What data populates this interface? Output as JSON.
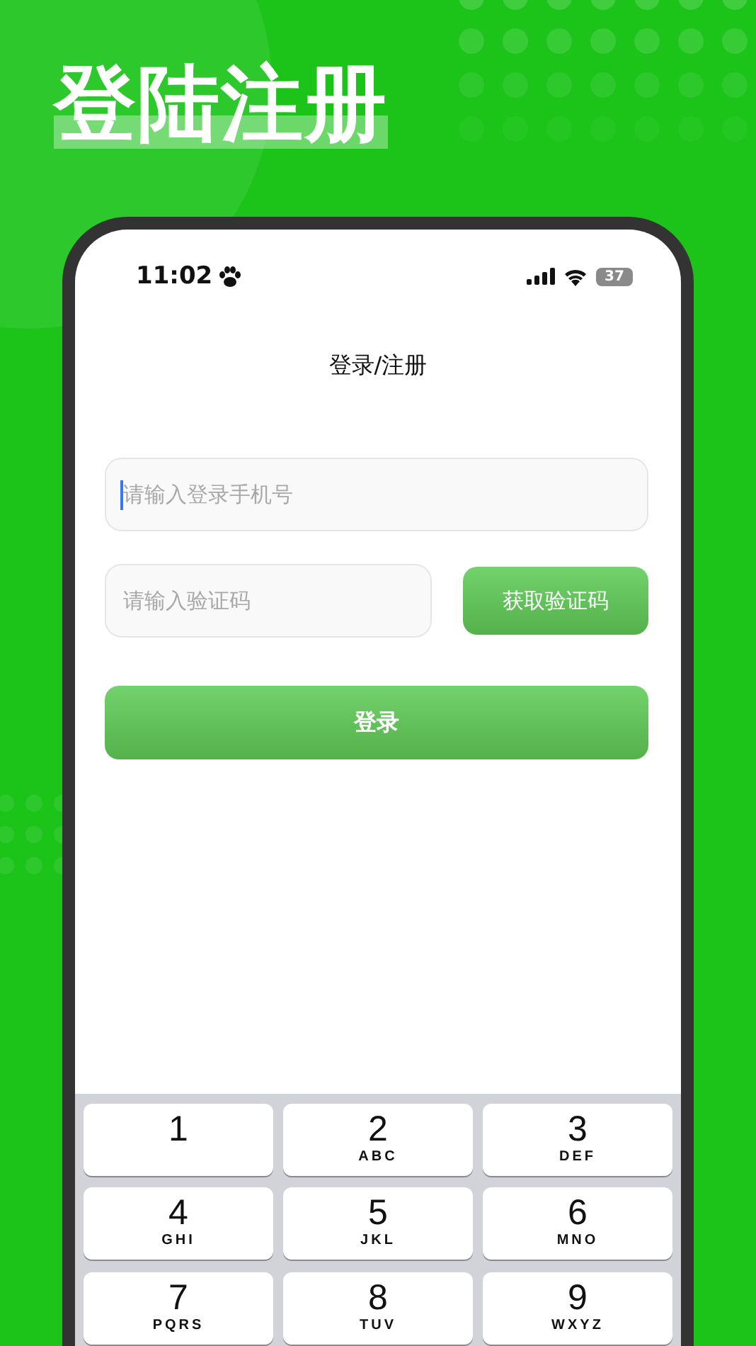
{
  "headline": "登陆注册",
  "status_bar": {
    "time": "11:02",
    "battery": "37"
  },
  "screen_title": "登录/注册",
  "phone_field": {
    "placeholder": "请输入登录手机号",
    "focused": true
  },
  "code_field": {
    "placeholder": "请输入验证码"
  },
  "code_button": "获取验证码",
  "login_button": "登录",
  "keypad": [
    {
      "digit": "1"
    },
    {
      "digit": "2",
      "letters": "ABC"
    },
    {
      "digit": "3",
      "letters": "DEF"
    },
    {
      "digit": "4",
      "letters": "GHI"
    },
    {
      "digit": "5",
      "letters": "JKL"
    },
    {
      "digit": "6",
      "letters": "MNO"
    },
    {
      "digit": "7",
      "letters": "PQRS"
    },
    {
      "digit": "8",
      "letters": "TUV"
    },
    {
      "digit": "9",
      "letters": "WXYZ"
    }
  ]
}
